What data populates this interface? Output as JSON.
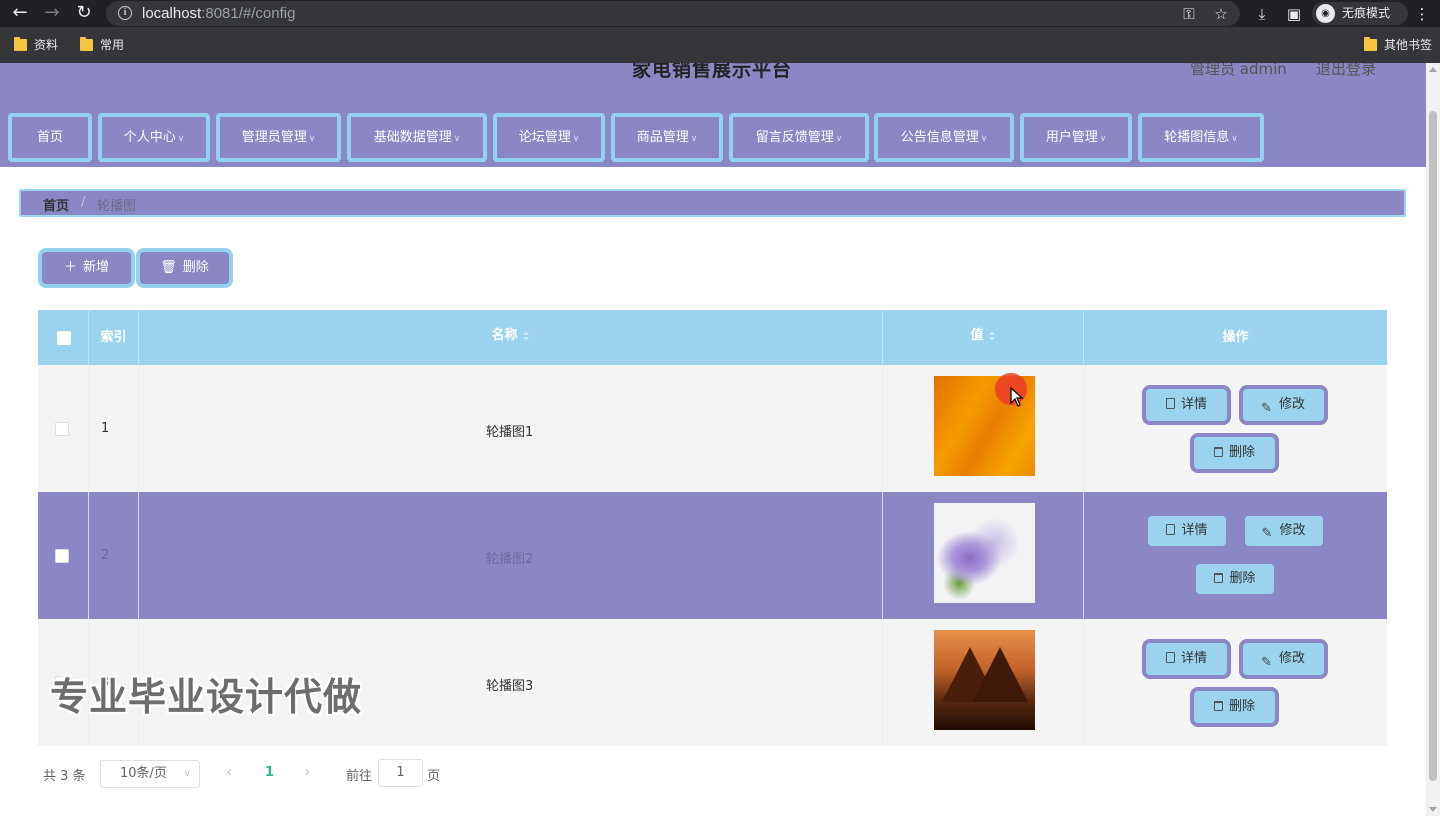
{
  "browser": {
    "url_host": "localhost",
    "url_rest": ":8081/#/config",
    "incognito_label": "无痕模式",
    "bookmarks": [
      "资料",
      "常用"
    ],
    "other_bookmarks": "其他书签"
  },
  "header": {
    "title": "家电销售展示平台",
    "admin_label": "管理员 admin",
    "logout": "退出登录"
  },
  "menu": {
    "items": [
      {
        "label": "首页",
        "has_dropdown": false
      },
      {
        "label": "个人中心",
        "has_dropdown": true
      },
      {
        "label": "管理员管理",
        "has_dropdown": true
      },
      {
        "label": "基础数据管理",
        "has_dropdown": true
      },
      {
        "label": "论坛管理",
        "has_dropdown": true
      },
      {
        "label": "商品管理",
        "has_dropdown": true
      },
      {
        "label": "留言反馈管理",
        "has_dropdown": true
      },
      {
        "label": "公告信息管理",
        "has_dropdown": true
      },
      {
        "label": "用户管理",
        "has_dropdown": true
      },
      {
        "label": "轮播图信息",
        "has_dropdown": true
      }
    ]
  },
  "breadcrumb": {
    "home": "首页",
    "separator": "/",
    "current": "轮播图"
  },
  "actions": {
    "add": "新增",
    "delete": "删除"
  },
  "table": {
    "columns": [
      "索引",
      "名称",
      "值",
      "操作"
    ],
    "rows": [
      {
        "index": "1",
        "name": "轮播图1",
        "image": "orange-abstract"
      },
      {
        "index": "2",
        "name": "轮播图2",
        "image": "purple-flowers"
      },
      {
        "index": "3",
        "name": "轮播图3",
        "image": "pyramids-sunset"
      }
    ],
    "row_actions": {
      "detail": "详情",
      "edit": "修改",
      "delete": "删除"
    }
  },
  "pagination": {
    "total": "共 3 条",
    "page_size": "10条/页",
    "current_page": "1",
    "goto_label": "前往",
    "goto_value": "1",
    "page_suffix": "页"
  },
  "watermark": "专业毕业设计代做",
  "colors": {
    "primary_purple": "#8a87c4",
    "accent_blue": "#9bd3ef",
    "pager_active": "#2fb58f"
  }
}
